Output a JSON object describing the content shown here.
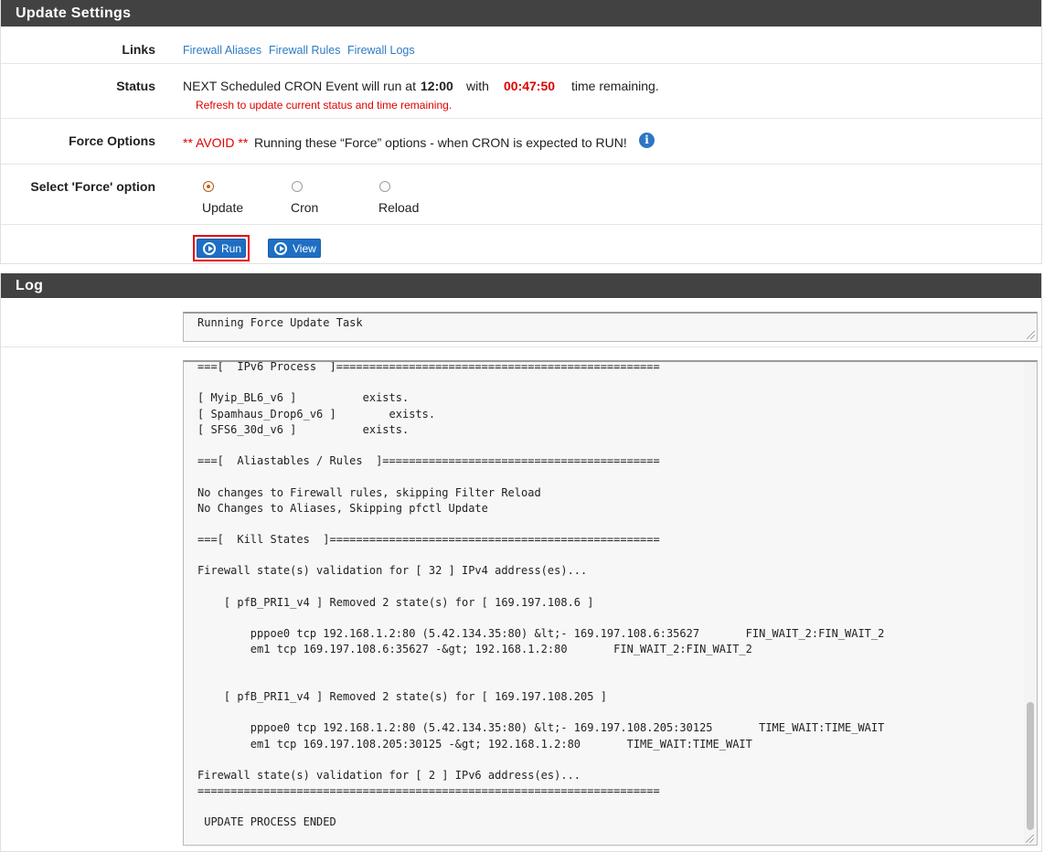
{
  "update_panel": {
    "title": "Update Settings",
    "links": {
      "label": "Links",
      "items": [
        "Firewall Aliases",
        "Firewall Rules",
        "Firewall Logs"
      ]
    },
    "status": {
      "label": "Status",
      "prefix": "NEXT Scheduled CRON Event will run at",
      "time": "12:00",
      "with": "with",
      "remaining": "00:47:50",
      "suffix": "time remaining.",
      "refresh_note": "Refresh to update current status and time remaining."
    },
    "force_options": {
      "label": "Force Options",
      "avoid": "** AVOID **",
      "text": "Running these “Force” options - when CRON is expected to RUN!"
    },
    "select_force": {
      "label": "Select 'Force' option",
      "options": [
        {
          "label": "Update",
          "checked": true
        },
        {
          "label": "Cron",
          "checked": false
        },
        {
          "label": "Reload",
          "checked": false
        }
      ]
    },
    "buttons": {
      "run": "Run",
      "view": "View"
    }
  },
  "log_panel": {
    "title": "Log",
    "task_text": "Running Force Update Task",
    "lines": [
      "===[  IPv6 Process  ]=================================================",
      "",
      "[ Myip_BL6_v6 ]          exists.",
      "[ Spamhaus_Drop6_v6 ]        exists.",
      "[ SFS6_30d_v6 ]          exists.",
      "",
      "===[  Aliastables / Rules  ]==========================================",
      "",
      "No changes to Firewall rules, skipping Filter Reload",
      "No Changes to Aliases, Skipping pfctl Update",
      "",
      "===[  Kill States  ]==================================================",
      "",
      "Firewall state(s) validation for [ 32 ] IPv4 address(es)...",
      "",
      "    [ pfB_PRI1_v4 ] Removed 2 state(s) for [ 169.197.108.6 ]",
      "",
      "        pppoe0 tcp 192.168.1.2:80 (5.42.134.35:80) &lt;- 169.197.108.6:35627       FIN_WAIT_2:FIN_WAIT_2",
      "        em1 tcp 169.197.108.6:35627 -&gt; 192.168.1.2:80       FIN_WAIT_2:FIN_WAIT_2",
      "",
      "",
      "    [ pfB_PRI1_v4 ] Removed 2 state(s) for [ 169.197.108.205 ]",
      "",
      "        pppoe0 tcp 192.168.1.2:80 (5.42.134.35:80) &lt;- 169.197.108.205:30125       TIME_WAIT:TIME_WAIT",
      "        em1 tcp 169.197.108.205:30125 -&gt; 192.168.1.2:80       TIME_WAIT:TIME_WAIT",
      "",
      "Firewall state(s) validation for [ 2 ] IPv6 address(es)...",
      "======================================================================",
      "",
      " UPDATE PROCESS ENDED"
    ]
  },
  "colors": {
    "heading_bg": "#424242",
    "link": "#2d7ac4",
    "alert_red": "#e00000",
    "button_blue": "#1e6fc4",
    "highlight_red": "#e8000b"
  }
}
